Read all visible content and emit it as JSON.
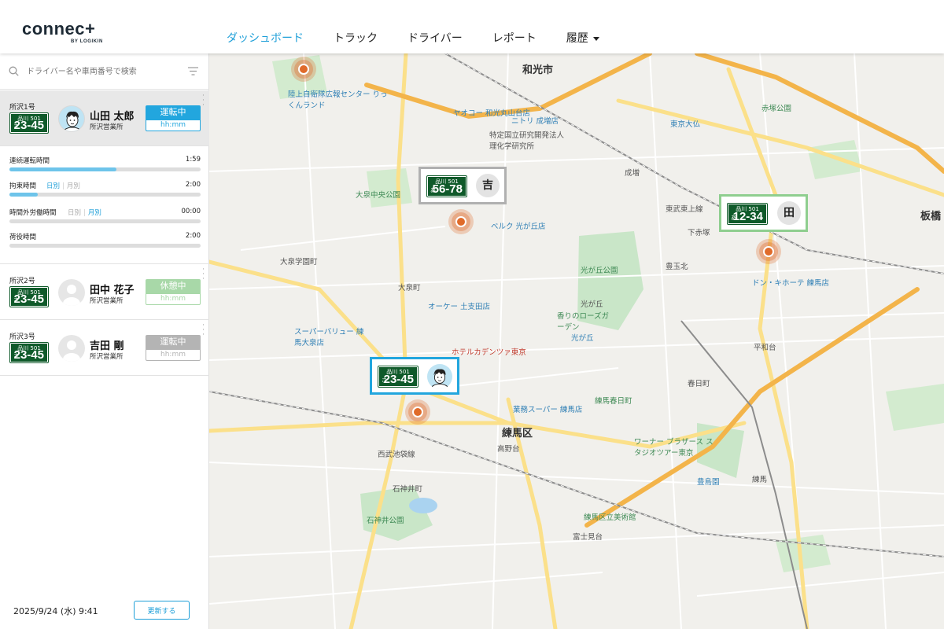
{
  "header": {
    "logo": "connec+",
    "logo_sub": "BY LOGIKIN",
    "nav": [
      {
        "label": "ダッシュボード",
        "active": true
      },
      {
        "label": "トラック",
        "active": false
      },
      {
        "label": "ドライバー",
        "active": false
      },
      {
        "label": "レポート",
        "active": false
      },
      {
        "label": "履歴",
        "active": false,
        "dropdown": true
      }
    ]
  },
  "sidebar": {
    "search_placeholder": "ドライバー名や車両番号で検索",
    "drivers": [
      {
        "vehicle": "所沢1号",
        "plate_top": "品川 501",
        "plate_kana": "さ",
        "plate_num": "23-45",
        "name": "山田 太郎",
        "office": "所沢営業所",
        "status": "運転中",
        "time": "hh:mm",
        "selected": true
      },
      {
        "vehicle": "所沢2号",
        "plate_top": "品川 501",
        "plate_kana": "さ",
        "plate_num": "23-45",
        "name": "田中 花子",
        "office": "所沢営業所",
        "status": "休憩中",
        "time": "hh:mm",
        "selected": false
      },
      {
        "vehicle": "所沢3号",
        "plate_top": "品川 501",
        "plate_kana": "さ",
        "plate_num": "23-45",
        "name": "吉田 剛",
        "office": "所沢営業所",
        "status": "運転中",
        "time": "hh:mm",
        "selected": false
      }
    ],
    "details": {
      "continuous_label": "連続運転時間",
      "continuous_value": "1:59",
      "continuous_progress": 0.56,
      "binding_label": "拘束時間",
      "binding_toggle_on": "日別",
      "binding_toggle_off": "月別",
      "binding_value": "2:00",
      "binding_progress": 0.15,
      "overtime_label": "時間外労働時間",
      "overtime_toggle_off": "日別",
      "overtime_toggle_on": "月別",
      "overtime_value": "00:00",
      "overtime_progress": 0.0,
      "cargo_label": "荷役時間",
      "cargo_value": "2:00",
      "cargo_progress": 0.0
    },
    "footer": {
      "date": "2025/9/24 (水) 9:41",
      "refresh_label": "更新する"
    }
  },
  "map": {
    "labels": {
      "nerima": "練馬区",
      "wako": "和光市",
      "itabashi": "板橋",
      "hikarigaoka_park": "光が丘公園",
      "hikarigaoka": "光が丘",
      "oizumi": "大泉町",
      "oizumi_gakuen": "大泉学園町",
      "nerima_st": "練馬",
      "takanodai": "高野台",
      "shakujii": "石神井町",
      "shakujii_park": "石神井公園",
      "fujimidai": "富士見台",
      "toyotamakita": "豊玉北",
      "nakamura": "中村南",
      "kasuga": "春日町",
      "heiwadai": "平和台",
      "shimoakatsuka": "下赤塚",
      "narimasu": "成増",
      "tokyo_daibutsu": "東京大仏",
      "akatsuka_park": "赤塚公園",
      "oizumi_central_park": "大泉中央公園",
      "rose_garden": "香りのローズガーデン",
      "nerima_kasugacho": "練馬春日町",
      "toshimaen": "豊島園",
      "warner": "ワーナー ブラザース スタジオツアー東京",
      "art_museum": "練馬区立美術館",
      "hotel": "ホテルカデンツァ東京",
      "super_value": "スーパーバリュー 練馬大泉店",
      "ok": "オーケー 土支田店",
      "belc": "ベルク 光が丘店",
      "nitori": "ニトリ 成増店",
      "yaoko": "ヤオコー 和光丸山台店",
      "riken": "特定国立研究開発法人 理化学研究所",
      "donki": "ドン・キホーテ 練馬店",
      "rikujieitai": "陸上自衛隊広報センター りっくんランド",
      "gyomu": "業務スーパー 練馬店",
      "hikarigaoka_st": "光が丘",
      "shakujii_koen_st": "石神井公園",
      "tobu_tojo": "東武東上線",
      "seibu_ikebukuro": "西武池袋線"
    },
    "route_numbers": [
      "443",
      "441",
      "311",
      "24",
      "25",
      "233",
      "8",
      "17",
      "108",
      "E17",
      "C3",
      "112",
      "68"
    ],
    "callouts": [
      {
        "plate_top": "品川 501",
        "plate_kana": "あ",
        "plate_num": "56-78",
        "avatar_text": "吉",
        "color": "#b0b0b0"
      },
      {
        "plate_top": "品川 501",
        "plate_kana": "あ",
        "plate_num": "12-34",
        "avatar_text": "田",
        "color": "#8fce8f"
      },
      {
        "plate_top": "品川 501",
        "plate_kana": "さ",
        "plate_num": "23-45",
        "avatar_text": "",
        "color": "#22a6de"
      }
    ]
  },
  "colors": {
    "accent": "#1e9fd8",
    "driving": "#22a6de",
    "rest": "#a8d8a8",
    "off": "#b4b4b4",
    "pin": "#e06b2a",
    "plate": "#0f5a2a"
  }
}
